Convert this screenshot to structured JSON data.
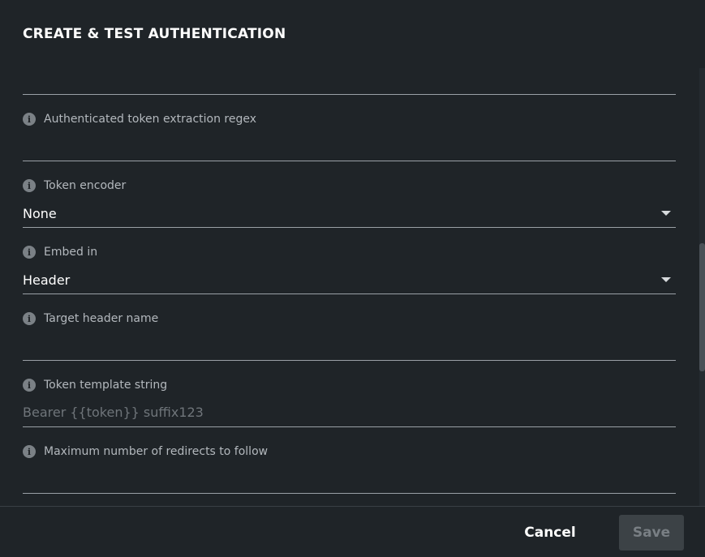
{
  "dialog": {
    "title": "CREATE & TEST AUTHENTICATION"
  },
  "fields": {
    "token_regex": {
      "label": "Authenticated token extraction regex",
      "value": ""
    },
    "token_encoder": {
      "label": "Token encoder",
      "value": "None"
    },
    "embed_in": {
      "label": "Embed in",
      "value": "Header"
    },
    "target_header": {
      "label": "Target header name",
      "value": ""
    },
    "token_template": {
      "label": "Token template string",
      "placeholder": "Bearer {{token}} suffix123"
    },
    "max_redirects": {
      "label": "Maximum number of redirects to follow",
      "value": ""
    }
  },
  "icons": {
    "info": "info-icon",
    "dropdown": "chevron-down-icon"
  },
  "footer": {
    "cancel_label": "Cancel",
    "save_label": "Save"
  },
  "colors": {
    "background": "#1f2428",
    "label": "#b3b8bd",
    "divider": "#9aa0a6",
    "save_disabled_bg": "#3c4246",
    "save_disabled_text": "#797f84"
  }
}
